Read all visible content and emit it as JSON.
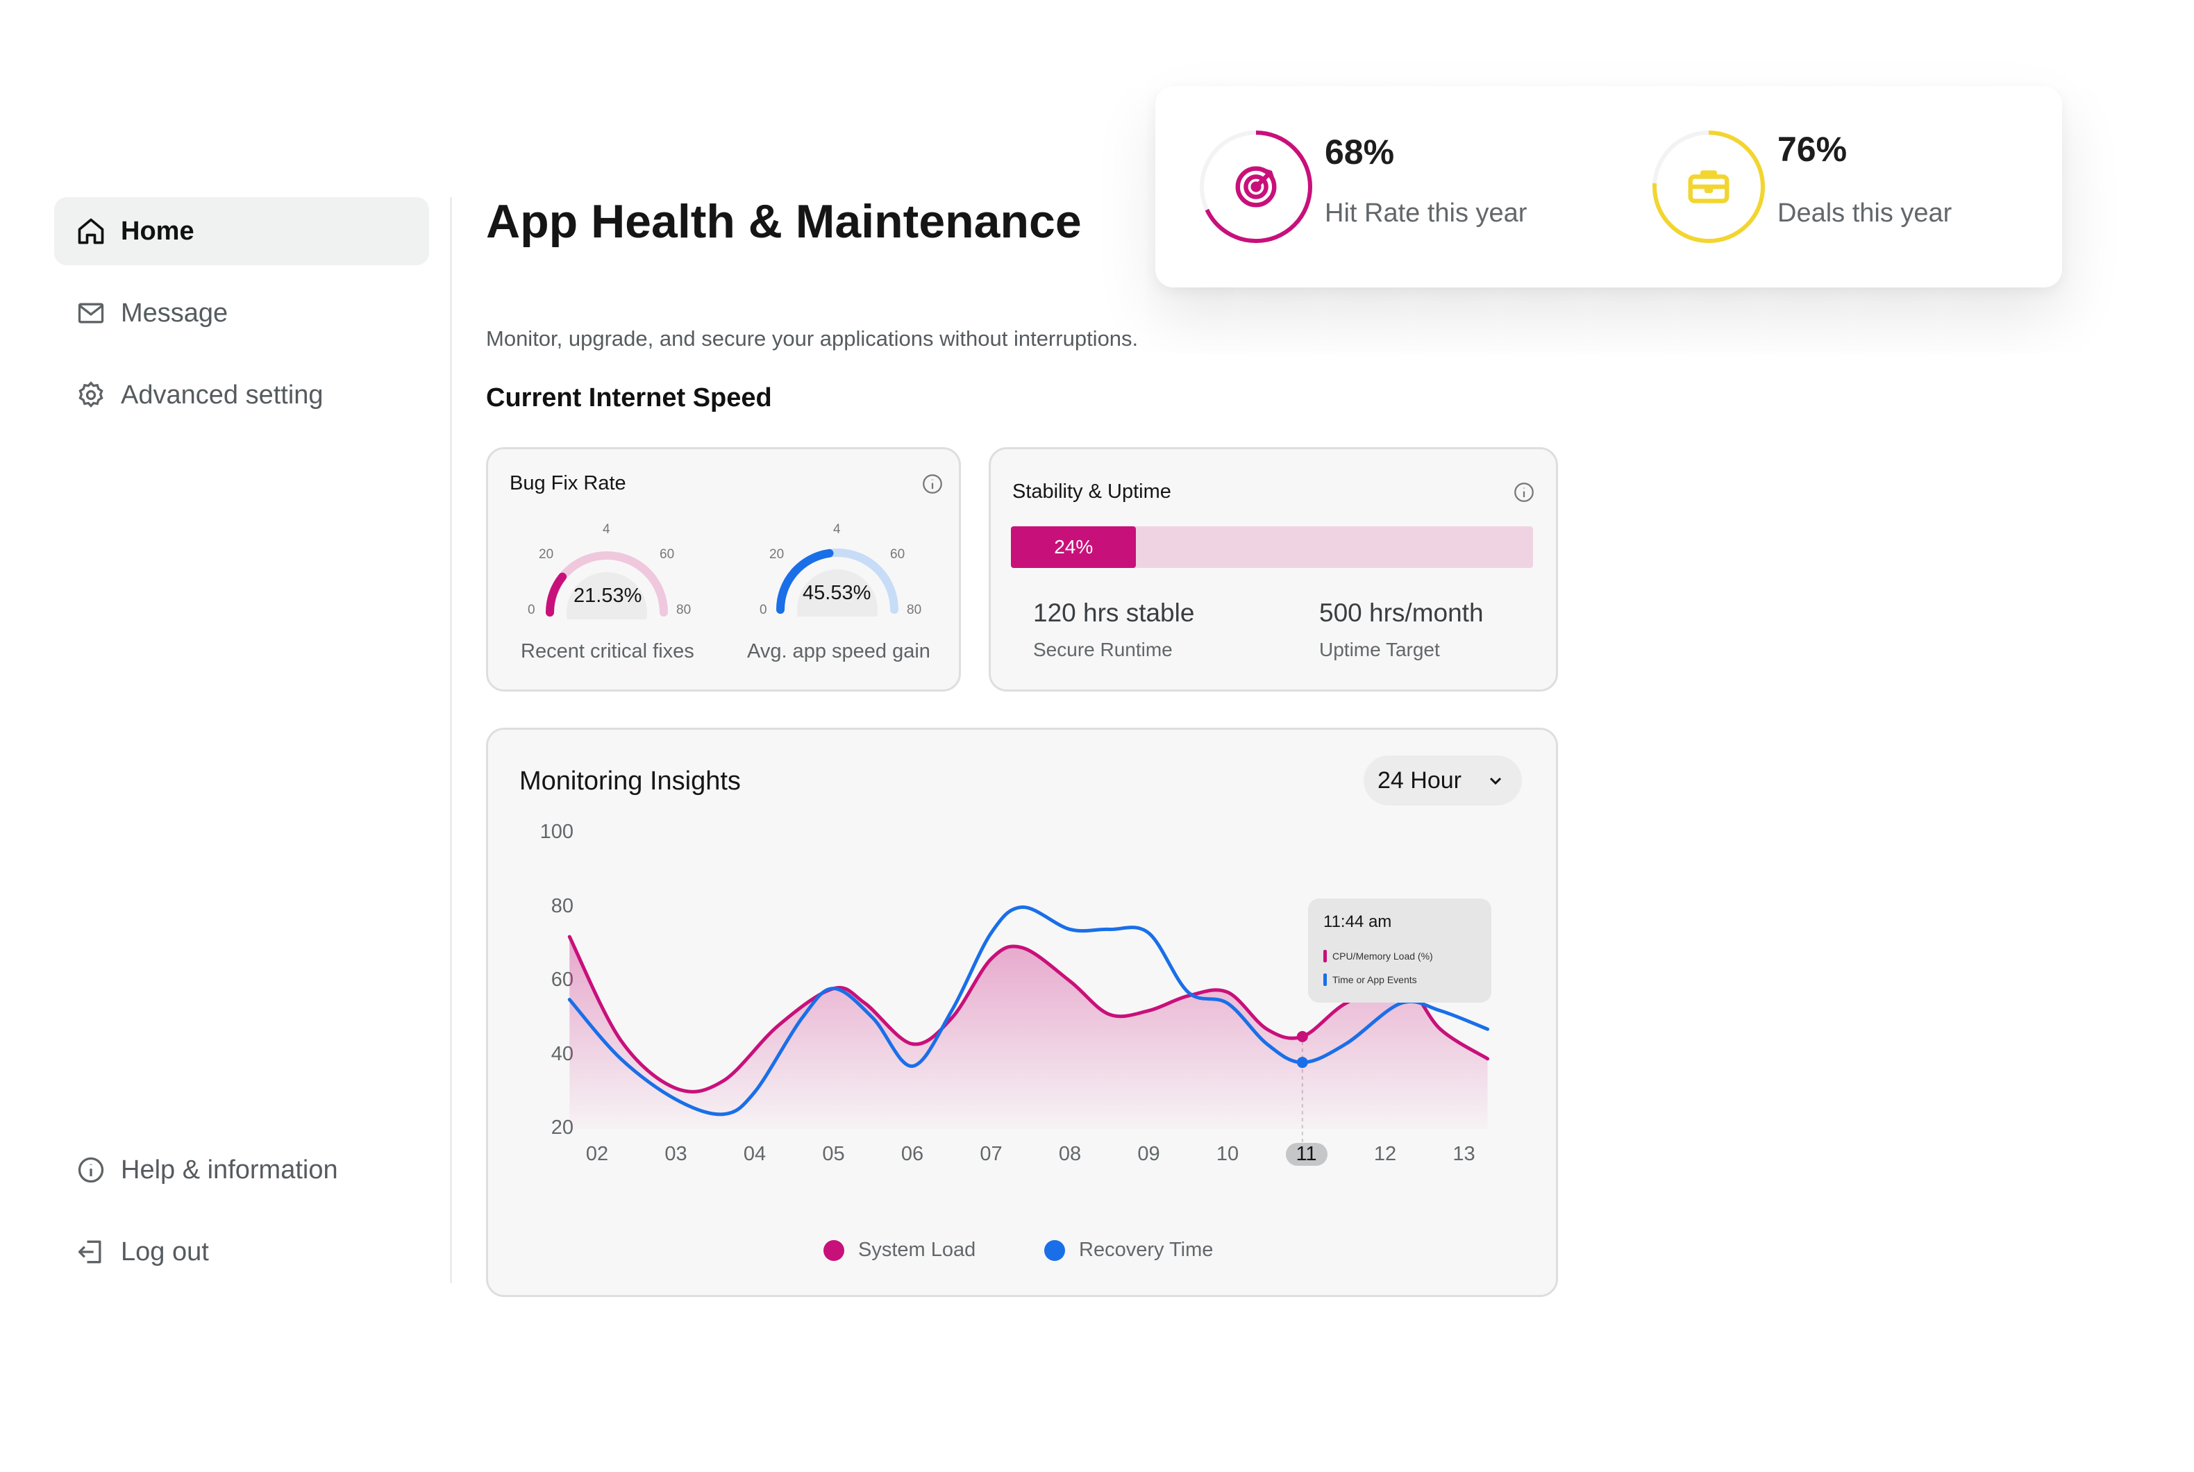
{
  "sidebar": {
    "items": [
      {
        "label": "Home",
        "icon": "home-icon",
        "active": true
      },
      {
        "label": "Message",
        "icon": "mail-icon",
        "active": false
      },
      {
        "label": "Advanced setting",
        "icon": "gear-icon",
        "active": false
      }
    ],
    "bottom_items": [
      {
        "label": "Help & information",
        "icon": "info-icon"
      },
      {
        "label": "Log out",
        "icon": "logout-icon"
      }
    ]
  },
  "header": {
    "title": "App Health & Maintenance",
    "subtitle": "Monitor, upgrade, and secure your applications without interruptions.",
    "section_title": "Current Internet Speed"
  },
  "kpis": [
    {
      "value": "68%",
      "label": "Hit Rate this year",
      "icon": "target-icon",
      "color": "#c8107a",
      "fraction": 0.68
    },
    {
      "value": "76%",
      "label": "Deals this year",
      "icon": "briefcase-icon",
      "color": "#f2d52f",
      "fraction": 0.76
    }
  ],
  "bug_fix": {
    "title": "Bug Fix Rate",
    "gauges": [
      {
        "value": "21.53%",
        "caption": "Recent critical fixes",
        "fraction": 0.2153,
        "color": "#c8107a",
        "track": "#efc8de",
        "ticks": [
          "0",
          "20",
          "4",
          "60",
          "80"
        ]
      },
      {
        "value": "45.53%",
        "caption": "Avg. app speed gain",
        "fraction": 0.4553,
        "color": "#1a6fe8",
        "track": "#c7dcf7",
        "ticks": [
          "0",
          "20",
          "4",
          "60",
          "80"
        ]
      }
    ]
  },
  "stability": {
    "title": "Stability & Uptime",
    "progress_label": "24%",
    "progress": 0.24,
    "stats": [
      {
        "value": "120 hrs stable",
        "label": "Secure Runtime"
      },
      {
        "value": "500 hrs/month",
        "label": "Uptime Target"
      }
    ]
  },
  "monitoring": {
    "title": "Monitoring Insights",
    "range_select": "24 Hour",
    "tooltip": {
      "time": "11:44 am",
      "rows": [
        "CPU/Memory Load (%)",
        "Time or App Events"
      ]
    }
  },
  "chart_data": {
    "type": "line",
    "title": "Monitoring Insights",
    "x": [
      "02",
      "03",
      "04",
      "05",
      "06",
      "07",
      "08",
      "09",
      "10",
      "11",
      "12",
      "13"
    ],
    "y_ticks": [
      "100",
      "80",
      "60",
      "40",
      "20"
    ],
    "ylim": [
      20,
      100
    ],
    "active_x": "11",
    "grid": false,
    "legend_placement": "bottom",
    "series": [
      {
        "name": "System Load",
        "color": "#c8107a",
        "filled": true,
        "points": [
          [
            1.65,
            72
          ],
          [
            2.3,
            44
          ],
          [
            3,
            31
          ],
          [
            3.6,
            33
          ],
          [
            4.3,
            48
          ],
          [
            5,
            58
          ],
          [
            5.4,
            54
          ],
          [
            6,
            43
          ],
          [
            6.5,
            50
          ],
          [
            7,
            66
          ],
          [
            7.4,
            69
          ],
          [
            8,
            60
          ],
          [
            8.5,
            51
          ],
          [
            9,
            52
          ],
          [
            9.5,
            56
          ],
          [
            10,
            57
          ],
          [
            10.5,
            47
          ],
          [
            10.95,
            45
          ],
          [
            11.5,
            54
          ],
          [
            12.2,
            60
          ],
          [
            12.7,
            47
          ],
          [
            13.3,
            39
          ]
        ]
      },
      {
        "name": "Recovery Time",
        "color": "#1a6fe8",
        "filled": false,
        "points": [
          [
            1.65,
            55
          ],
          [
            2.3,
            39
          ],
          [
            3,
            28
          ],
          [
            3.6,
            24
          ],
          [
            4,
            30
          ],
          [
            4.6,
            50
          ],
          [
            5,
            58
          ],
          [
            5.5,
            50
          ],
          [
            6,
            37
          ],
          [
            6.5,
            52
          ],
          [
            7,
            73
          ],
          [
            7.4,
            80
          ],
          [
            8,
            74
          ],
          [
            8.5,
            74
          ],
          [
            9,
            73
          ],
          [
            9.5,
            57
          ],
          [
            10,
            54
          ],
          [
            10.5,
            43
          ],
          [
            10.95,
            38
          ],
          [
            11.5,
            43
          ],
          [
            12.2,
            54
          ],
          [
            12.7,
            52
          ],
          [
            13.3,
            47
          ]
        ]
      }
    ]
  }
}
